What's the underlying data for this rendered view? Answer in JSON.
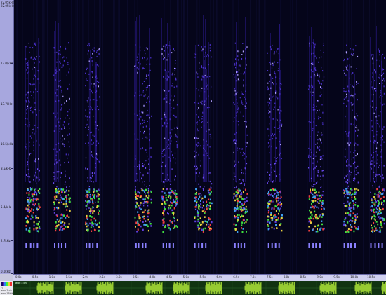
{
  "app": {
    "freq_header": [
      "22.05kHz",
      "22.05kHz"
    ],
    "freq_labels": [
      {
        "text": "17.0/kHz",
        "value": 17.0
      },
      {
        "text": "13.7kHz",
        "value": 13.7
      },
      {
        "text": "10.5/kHz",
        "value": 10.5
      },
      {
        "text": "8.5/kHz",
        "value": 8.5
      },
      {
        "text": "5.4/kHz",
        "value": 5.4
      },
      {
        "text": "2.7kHz",
        "value": 2.7
      },
      {
        "text": "0.0kHz",
        "value": 0.0
      }
    ],
    "time_start": "0.0s",
    "time_labels": [
      "0.0s",
      "0.5s",
      "1.0s",
      "1.5s",
      "2.0s",
      "2.5s",
      "3.0s",
      "3.5s",
      "4.0s",
      "4.5s",
      "5.0s",
      "5.5s",
      "6.0s",
      "6.5s",
      "7.0s",
      "7.5s",
      "8.0s",
      "8.5s",
      "9.0s",
      "9.5s",
      "10.0s",
      "10.5s"
    ],
    "waveform_label": "wav 1 ch",
    "left_panel_text": [
      "F/T",
      "wav 1 ch",
      "wav 16bit"
    ],
    "colors": {
      "ruler_bg": "#a7a7de",
      "spectro_bg": "#05051a",
      "wave_bg": "#113311",
      "wave_fg": "#b8f03a"
    },
    "color_legend": [
      "#1a0a6a",
      "#5a1ab8",
      "#2a8af0",
      "#3af03a",
      "#f0d030",
      "#f03030"
    ]
  }
}
